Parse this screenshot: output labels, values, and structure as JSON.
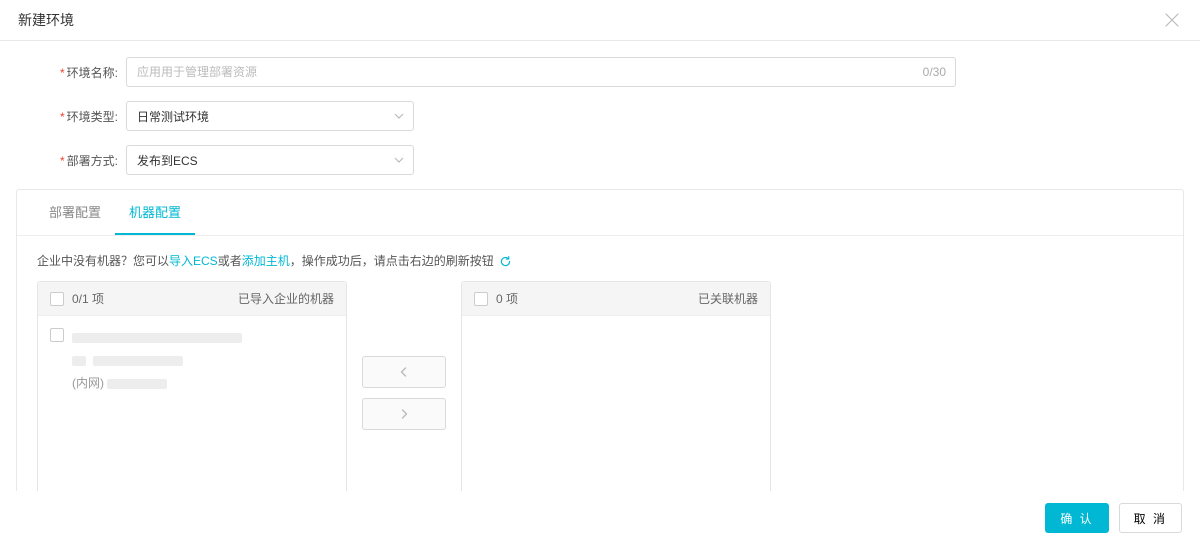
{
  "dialog": {
    "title": "新建环境"
  },
  "form": {
    "nameLabel": "环境名称:",
    "namePlaceholder": "应用用于管理部署资源",
    "nameCount": "0/30",
    "typeLabel": "环境类型:",
    "typeValue": "日常测试环境",
    "deployLabel": "部署方式:",
    "deployValue": "发布到ECS"
  },
  "tabs": {
    "deployConfig": "部署配置",
    "machineConfig": "机器配置"
  },
  "hint": {
    "prefix": "企业中没有机器？您可以",
    "importEcs": "导入ECS",
    "or": "或者",
    "addHost": "添加主机",
    "suffix": "，操作成功后，请点击右边的刷新按钮"
  },
  "transfer": {
    "leftCount": "0/1 项",
    "leftTitle": "已导入企业的机器",
    "rightCount": "0 项",
    "rightTitle": "已关联机器",
    "itemNet": "(内网)"
  },
  "footer": {
    "ok": "确 认",
    "cancel": "取 消"
  }
}
